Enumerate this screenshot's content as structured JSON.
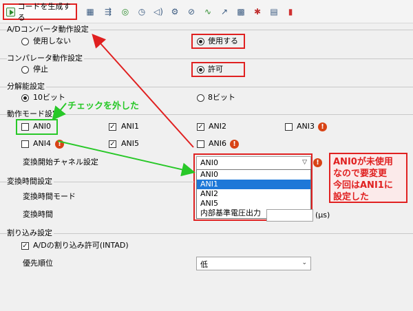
{
  "toolbar": {
    "generate_label": "コードを生成する",
    "icons": [
      "timer-icon",
      "dma-icon",
      "watchdog-icon",
      "clock-icon",
      "buzzer-icon",
      "serial-icon",
      "comparator-icon",
      "adc-icon",
      "output-icon",
      "chip-icon",
      "interrupt-icon",
      "memory-icon",
      "battery-icon"
    ]
  },
  "sections": {
    "ad_operation": "A/Dコンバータ動作設定",
    "comparator": "コンパレータ動作設定",
    "resolution": "分解能設定",
    "mode": "動作モード設定",
    "conversion_time": "変換時間設定",
    "interrupt": "割り込み設定"
  },
  "ad_operation": {
    "off_label": "使用しない",
    "on_label": "使用する",
    "selected": "on"
  },
  "comparator": {
    "stop_label": "停止",
    "allow_label": "許可",
    "selected": "allow"
  },
  "resolution": {
    "opt1": "10ビット",
    "opt2": "8ビット",
    "selected": "10"
  },
  "mode": {
    "channels": [
      {
        "label": "ANI0",
        "checked": false,
        "warn": false
      },
      {
        "label": "ANI1",
        "checked": true,
        "warn": false
      },
      {
        "label": "ANI2",
        "checked": true,
        "warn": false
      },
      {
        "label": "ANI3",
        "checked": false,
        "warn": true
      },
      {
        "label": "ANI4",
        "checked": false,
        "warn": true
      },
      {
        "label": "ANI5",
        "checked": true,
        "warn": false
      },
      {
        "label": "ANI6",
        "checked": false,
        "warn": true
      }
    ],
    "start_channel_label": "変換開始チャネル設定",
    "start_channel_value": "ANI0",
    "dropdown_options": [
      "ANI0",
      "ANI1",
      "ANI2",
      "ANI5",
      "内部基準電圧出力"
    ],
    "dropdown_selected_index": 1
  },
  "conversion_time": {
    "mode_label": "変換時間モード",
    "time_label": "変換時間",
    "unit": "(μs)"
  },
  "interrupt": {
    "enable_label": "A/Dの割り込み許可(INTAD)",
    "enable_checked": true,
    "priority_label": "優先順位",
    "priority_value": "低"
  },
  "annotations": {
    "green_note": "チェックを外した",
    "red_note_lines": [
      "ANI0が未使用",
      "なので要変更",
      "今回はANI1に",
      "設定した"
    ]
  },
  "colors": {
    "annotation_red": "#e02020",
    "annotation_green": "#28c828",
    "selection_blue": "#1e78d8"
  }
}
